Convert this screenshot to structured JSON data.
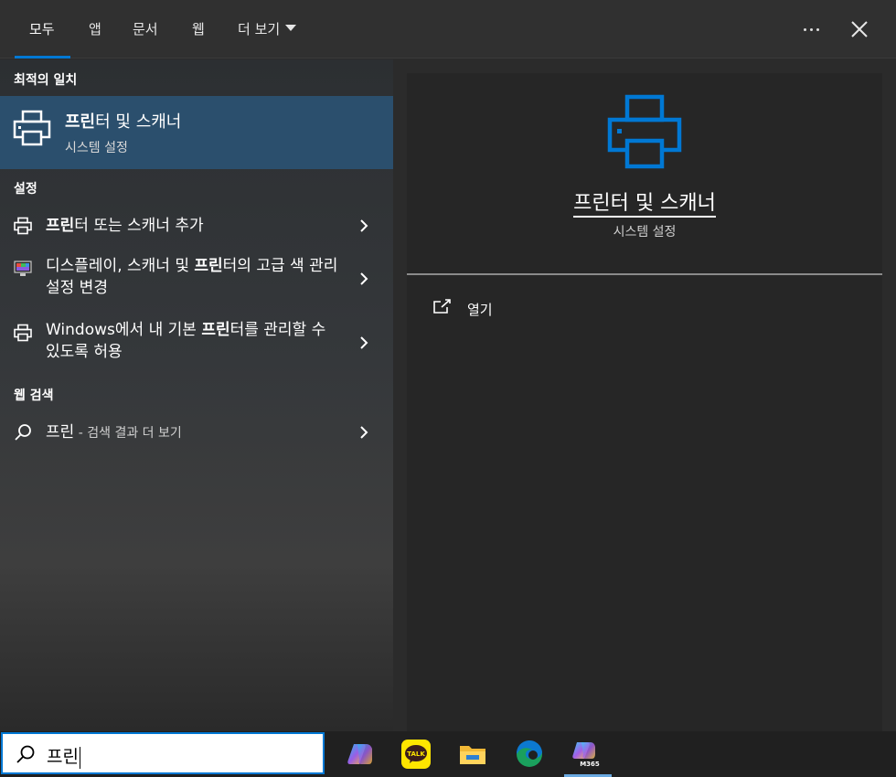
{
  "tabs": [
    {
      "label": "모두",
      "active": true
    },
    {
      "label": "앱"
    },
    {
      "label": "문서"
    },
    {
      "label": "웹"
    },
    {
      "label": "더 보기"
    }
  ],
  "sections": {
    "best_match": "최적의 일치",
    "settings": "설정",
    "web_search": "웹 검색"
  },
  "best_match": {
    "title_bold": "프린",
    "title_rest": "터 및 스캐너",
    "subtitle": "시스템 설정",
    "icon": "printer-icon"
  },
  "settings_results": [
    {
      "bold": "프린",
      "rest": "터 또는 스캐너 추가",
      "icon": "printer-icon"
    },
    {
      "pre": "디스플레이, 스캐너 및 ",
      "bold": "프린",
      "rest": "터의 고급 색 관리 설정 변경",
      "icon": "display-color-icon"
    },
    {
      "pre": "Windows에서 내 기본 ",
      "bold": "프린",
      "rest": "터를 관리할 수 있도록 허용",
      "icon": "printer-icon"
    }
  ],
  "web_result": {
    "query": "프린",
    "suffix": " - 검색 결과 더 보기",
    "icon": "search-icon"
  },
  "detail": {
    "title": "프린터 및 스캐너",
    "subtitle": "시스템 설정",
    "open_label": "열기",
    "icon": "printer-icon",
    "accent": "#0078d4"
  },
  "search": {
    "value": "프린",
    "icon": "search-icon"
  },
  "taskbar": {
    "apps": [
      {
        "name": "copilot-icon"
      },
      {
        "name": "kakaotalk-icon",
        "text": "TALK"
      },
      {
        "name": "file-explorer-icon"
      },
      {
        "name": "edge-icon"
      },
      {
        "name": "m365-copilot-icon",
        "text": "M365",
        "active": true
      }
    ]
  }
}
